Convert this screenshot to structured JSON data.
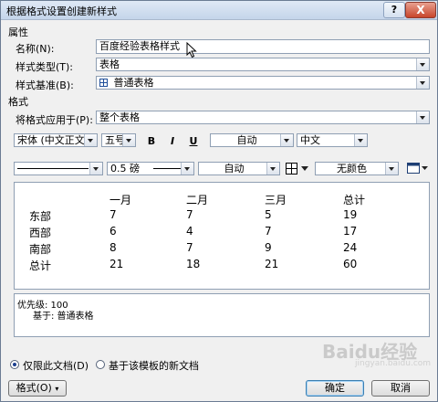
{
  "window": {
    "title": "根据格式设置创建新样式",
    "help_label": "?",
    "close_label": "X"
  },
  "properties": {
    "group_label": "属性",
    "name_label": "名称(N):",
    "name_value": "百度经验表格样式",
    "style_type_label": "样式类型(T):",
    "style_type_value": "表格",
    "style_based_label": "样式基准(B):",
    "style_based_value": "普通表格"
  },
  "format": {
    "group_label": "格式",
    "apply_to_label": "将格式应用于(P):",
    "apply_to_value": "整个表格",
    "font_value": "宋体 (中文正文)",
    "size_value": "五号",
    "bold": "B",
    "italic": "I",
    "underline": "U",
    "color_value": "自动",
    "language_value": "中文",
    "border_weight_value": "0.5 磅",
    "border_color_value": "自动",
    "shading_value": "无颜色"
  },
  "preview_table": {
    "headers": [
      "一月",
      "二月",
      "三月",
      "总计"
    ],
    "rows": [
      {
        "label": "东部",
        "values": [
          "7",
          "7",
          "5",
          "19"
        ]
      },
      {
        "label": "西部",
        "values": [
          "6",
          "4",
          "7",
          "17"
        ]
      },
      {
        "label": "南部",
        "values": [
          "8",
          "7",
          "9",
          "24"
        ]
      },
      {
        "label": "总计",
        "values": [
          "21",
          "18",
          "21",
          "60"
        ]
      }
    ]
  },
  "description": {
    "priority": "优先级: 100",
    "based_on": "基于: 普通表格"
  },
  "options": {
    "only_this_doc": "仅限此文档(D)",
    "new_docs_template": "基于该模板的新文档"
  },
  "buttons": {
    "format": "格式(O)",
    "ok": "确定",
    "cancel": "取消"
  },
  "watermark": {
    "text": "Baidu经验",
    "sub": "jingyan.baidu.com"
  }
}
